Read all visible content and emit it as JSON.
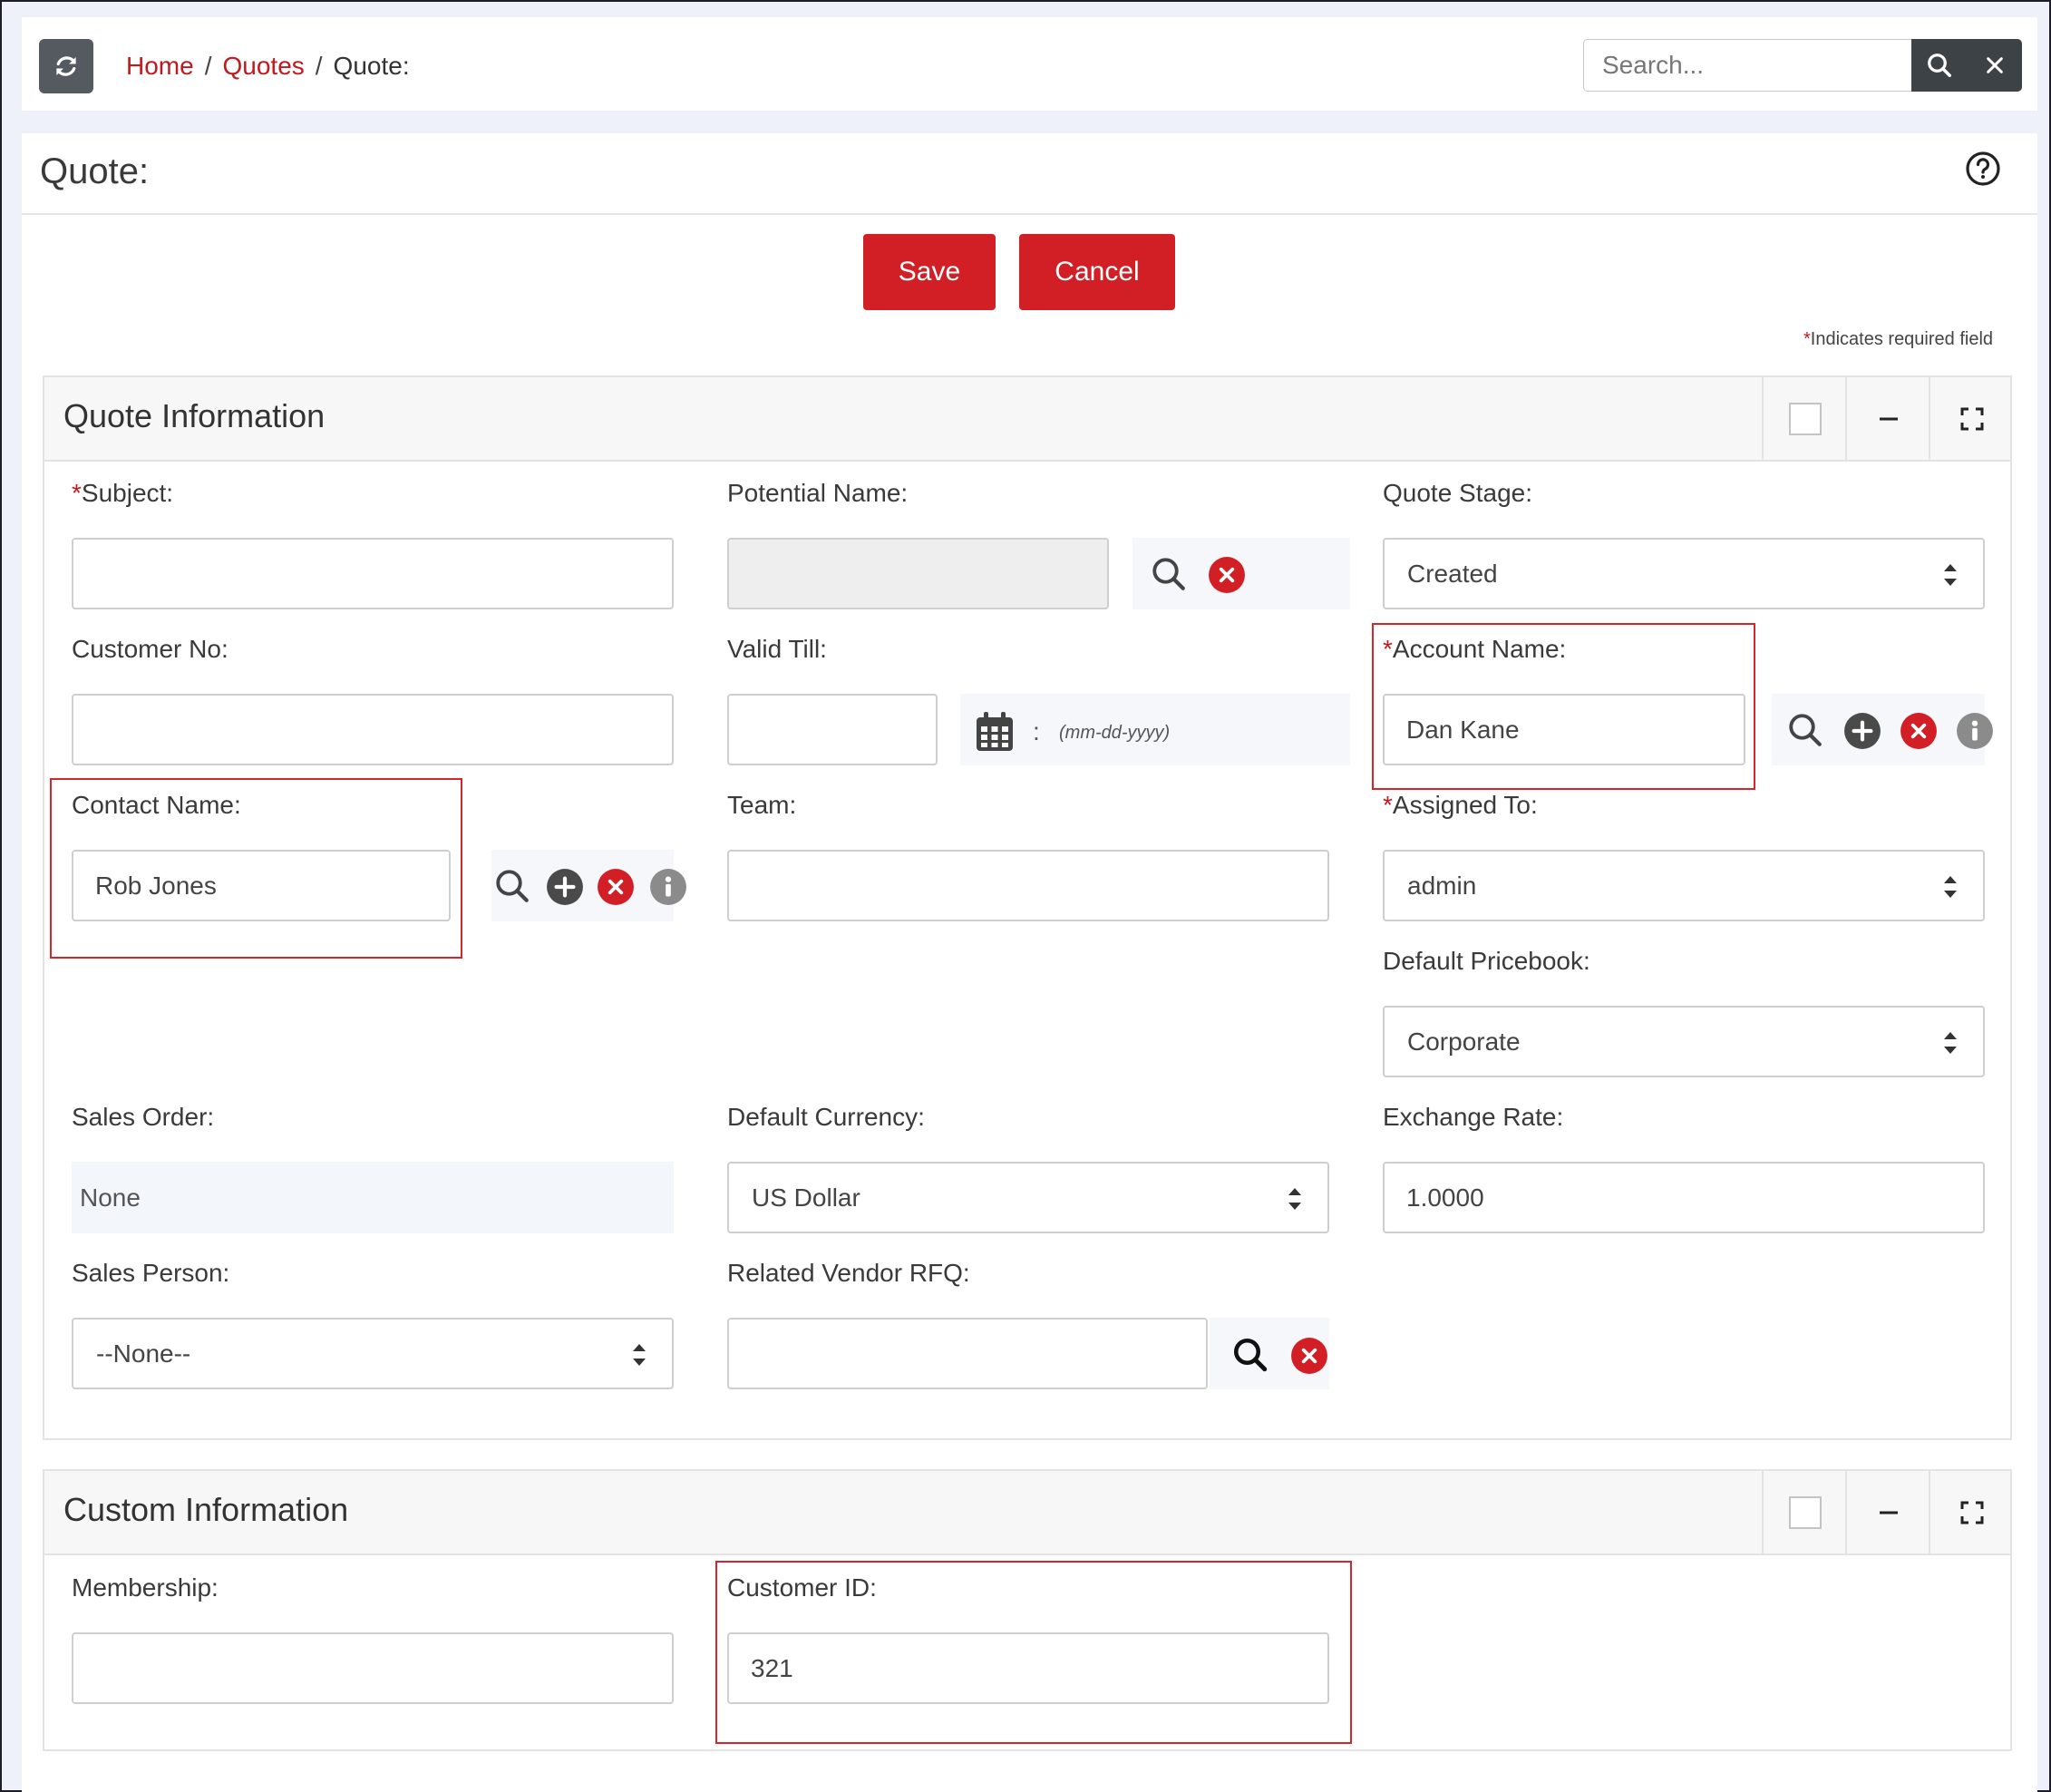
{
  "topbar": {
    "breadcrumb": {
      "home": "Home",
      "quotes": "Quotes",
      "current": "Quote:",
      "separator": "/"
    },
    "search_placeholder": "Search..."
  },
  "page": {
    "title": "Quote:",
    "save_label": "Save",
    "cancel_label": "Cancel",
    "required_note": "Indicates required field",
    "required_star": "*"
  },
  "quote_info": {
    "title": "Quote Information",
    "subject": {
      "label": "Subject:",
      "value": "",
      "required": "*"
    },
    "potential_name": {
      "label": "Potential Name:",
      "value": ""
    },
    "quote_stage": {
      "label": "Quote Stage:",
      "value": "Created"
    },
    "customer_no": {
      "label": "Customer No:",
      "value": ""
    },
    "valid_till": {
      "label": "Valid Till:",
      "value": "",
      "colon": ":",
      "hint": "(mm-dd-yyyy)"
    },
    "account_name": {
      "label": "Account Name:",
      "value": "Dan Kane",
      "required": "*"
    },
    "contact_name": {
      "label": "Contact Name:",
      "value": "Rob Jones"
    },
    "team": {
      "label": "Team:",
      "value": ""
    },
    "assigned_to": {
      "label": "Assigned To:",
      "value": "admin",
      "required": "*"
    },
    "default_pricebook": {
      "label": "Default Pricebook:",
      "value": "Corporate"
    },
    "sales_order": {
      "label": "Sales Order:",
      "value": "None"
    },
    "default_currency": {
      "label": "Default Currency:",
      "value": "US Dollar"
    },
    "exchange_rate": {
      "label": "Exchange Rate:",
      "value": "1.0000"
    },
    "sales_person": {
      "label": "Sales Person:",
      "value": "--None--"
    },
    "related_vendor_rfq": {
      "label": "Related Vendor RFQ:",
      "value": ""
    }
  },
  "custom_info": {
    "title": "Custom Information",
    "membership": {
      "label": "Membership:",
      "value": ""
    },
    "customer_id": {
      "label": "Customer ID:",
      "value": "321"
    }
  },
  "colors": {
    "brand_red": "#d21f26",
    "link_red": "#c4181f",
    "dark_button": "#3d4246"
  },
  "icons": [
    "refresh-icon",
    "search-icon",
    "close-icon",
    "help-icon",
    "minimize-icon",
    "expand-icon",
    "clear-icon",
    "add-icon",
    "info-icon",
    "calendar-icon",
    "sort-arrows-icon"
  ]
}
